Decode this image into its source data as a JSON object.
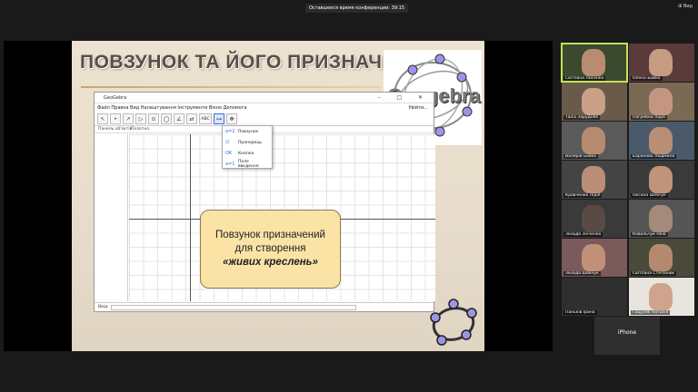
{
  "topbar": {
    "notice": "Оставшееся время конференции: 39:15",
    "view_label": "Вид"
  },
  "slide": {
    "title": "ПОВЗУНОК ТА ЙОГО ПРИЗНАЧЕННЯ",
    "logo_text": "Geogebra",
    "callout": {
      "line1": "Повзунок призначений",
      "line2": "для створення",
      "line3": "«живих креслень»"
    }
  },
  "geogebra": {
    "window_title": "GeoGebra",
    "window_buttons": "–  □  ✕",
    "menu": "Файл  Правка  Вид  Налаштування  Інструменти  Вікно  Допомога",
    "menu_right": "Увійти...",
    "algebra_label": "Панель об'єктів",
    "graphics_label": "Полотно",
    "tools": [
      "↖",
      "•",
      "↗",
      "▷",
      "⊙",
      "◯",
      "∠",
      "⇄",
      "ABC",
      "⊶",
      "✥"
    ],
    "dropdown": [
      {
        "icon": "a=2",
        "label": "Повзунок"
      },
      {
        "icon": "☑",
        "label": "Прапорець"
      },
      {
        "icon": "OK",
        "label": "Кнопка"
      },
      {
        "icon": "a=1",
        "label": "Поле введення"
      }
    ],
    "input_label": "Ввід:"
  },
  "participants": [
    {
      "name": "Світлана Лисенко",
      "face": "#b98c72",
      "bg": "#3b4a2f",
      "active": true
    },
    {
      "name": "Олена Бойко",
      "face": "#c79b82",
      "bg": "#5a3a3a",
      "active": false
    },
    {
      "name": "Таїса Зарудняк",
      "face": "#caa088",
      "bg": "#6a5a4a",
      "active": false
    },
    {
      "name": "Погребна Лідія",
      "face": "#c49680",
      "bg": "#7a6a55",
      "active": false
    },
    {
      "name": "Валерій Бойко",
      "face": "#b48a70",
      "bg": "#5a5a5a",
      "active": false
    },
    {
      "name": "Баранова Людмила",
      "face": "#b88e74",
      "bg": "#4a5a6a",
      "active": false
    },
    {
      "name": "Кравченко Лідія",
      "face": "#ba8f76",
      "bg": "#444",
      "active": false
    },
    {
      "name": "Оксана Шевчук",
      "face": "#bf947a",
      "bg": "#3a3a3a",
      "active": false
    },
    {
      "name": "Зінаїда Зінченко",
      "face": "#5a4a45",
      "bg": "#3a3a3a",
      "active": false
    },
    {
      "name": "Ковальчук Ніна",
      "face": "#a58a7a",
      "bg": "#555",
      "active": false
    },
    {
      "name": "Зінаїда Шевчук",
      "face": "#c09078",
      "bg": "#7a5a5a",
      "active": false
    },
    {
      "name": "Світлана Степанюк",
      "face": "#b48a6e",
      "bg": "#4a4a3a",
      "active": false
    },
    {
      "name": "Паньків Ірина",
      "face": "#2f2f2f",
      "bg": "#2f2f2f",
      "active": false
    },
    {
      "name": "Гоцуляк Наталія",
      "face": "#d0a48c",
      "bg": "#e8e4de",
      "active": false
    },
    {
      "name": "iPhone",
      "face": "#2f2f2f",
      "bg": "#2f2f2f",
      "active": false
    }
  ]
}
